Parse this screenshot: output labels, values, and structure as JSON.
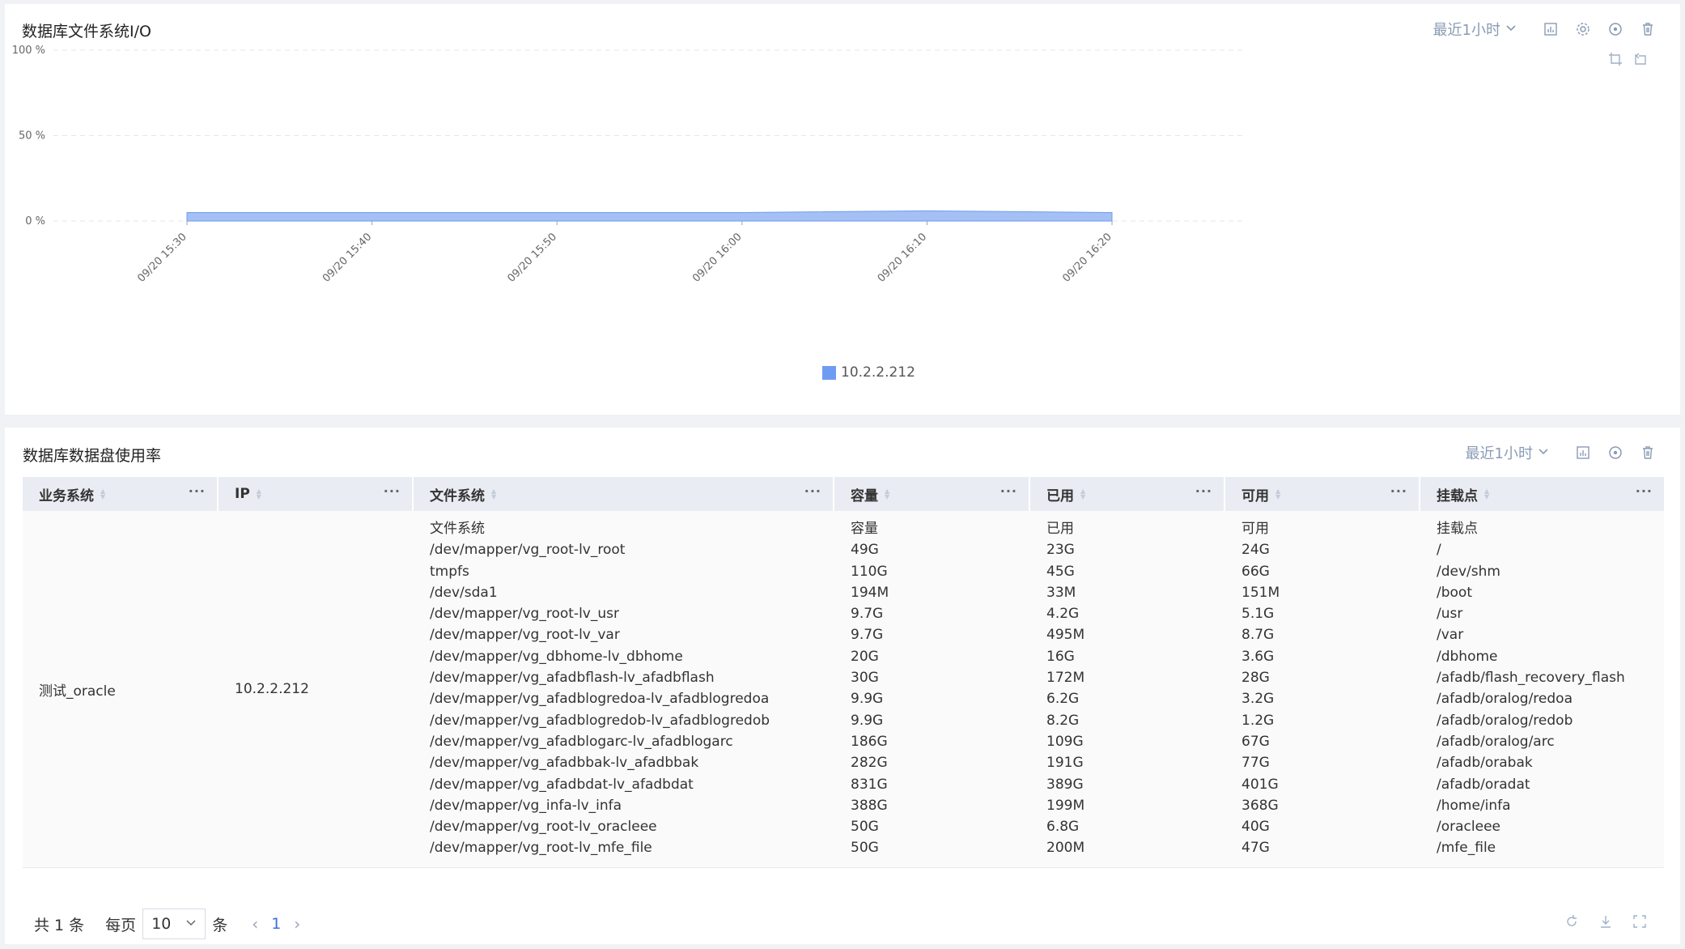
{
  "panel1": {
    "title": "数据库文件系统I/O",
    "time_range": "最近1小时"
  },
  "chart_data": {
    "type": "area",
    "x": [
      "09/20 15:30",
      "09/20 15:40",
      "09/20 15:50",
      "09/20 16:00",
      "09/20 16:10",
      "09/20 16:20"
    ],
    "y_ticks": [
      "100 %",
      "50 %",
      "0 %"
    ],
    "ylim": [
      0,
      100
    ],
    "series": [
      {
        "name": "10.2.2.212",
        "x": [
          0,
          1,
          2,
          3,
          4,
          5
        ],
        "values": [
          5,
          5,
          5,
          5,
          6,
          5
        ]
      }
    ],
    "grid": true,
    "legend_position": "bottom",
    "colors": {
      "series": "#6f9cf2",
      "fill": "#a4c0f4"
    }
  },
  "panel2": {
    "title": "数据库数据盘使用率",
    "time_range": "最近1小时"
  },
  "table": {
    "columns": [
      "业务系统",
      "IP",
      "文件系统",
      "容量",
      "已用",
      "可用",
      "挂载点"
    ],
    "row": {
      "system": "测试_oracle",
      "ip": "10.2.2.212",
      "filesystem": [
        "文件系统",
        "/dev/mapper/vg_root-lv_root",
        "tmpfs",
        "/dev/sda1",
        "/dev/mapper/vg_root-lv_usr",
        "/dev/mapper/vg_root-lv_var",
        "/dev/mapper/vg_dbhome-lv_dbhome",
        "/dev/mapper/vg_afadbflash-lv_afadbflash",
        "/dev/mapper/vg_afadblogredoa-lv_afadblogredoa",
        "/dev/mapper/vg_afadblogredob-lv_afadblogredob",
        "/dev/mapper/vg_afadblogarc-lv_afadblogarc",
        "/dev/mapper/vg_afadbbak-lv_afadbbak",
        "/dev/mapper/vg_afadbdat-lv_afadbdat",
        "/dev/mapper/vg_infa-lv_infa",
        "/dev/mapper/vg_root-lv_oracleee",
        "/dev/mapper/vg_root-lv_mfe_file"
      ],
      "capacity": [
        "容量",
        "49G",
        "110G",
        "194M",
        "9.7G",
        "9.7G",
        "20G",
        "30G",
        "9.9G",
        "9.9G",
        "186G",
        "282G",
        "831G",
        "388G",
        "50G",
        "50G"
      ],
      "used": [
        "已用",
        "23G",
        "45G",
        "33M",
        "4.2G",
        "495M",
        "16G",
        "172M",
        "6.2G",
        "8.2G",
        "109G",
        "191G",
        "389G",
        "199M",
        "6.8G",
        "200M"
      ],
      "available": [
        "可用",
        "24G",
        "66G",
        "151M",
        "5.1G",
        "8.7G",
        "3.6G",
        "28G",
        "3.2G",
        "1.2G",
        "67G",
        "77G",
        "401G",
        "368G",
        "40G",
        "47G"
      ],
      "mount": [
        "挂载点",
        "/",
        "/dev/shm",
        "/boot",
        "/usr",
        "/var",
        "/dbhome",
        "/afadb/flash_recovery_flash",
        "/afadb/oralog/redoa",
        "/afadb/oralog/redob",
        "/afadb/oralog/arc",
        "/afadb/orabak",
        "/afadb/oradat",
        "/home/infa",
        "/oracleee",
        "/mfe_file"
      ]
    },
    "more_icon": "···"
  },
  "pager": {
    "total": "共 1 条",
    "per_page_label": "每页",
    "per_page_value": "10",
    "unit": "条",
    "prev": "‹",
    "current_page": "1",
    "next": "›"
  }
}
